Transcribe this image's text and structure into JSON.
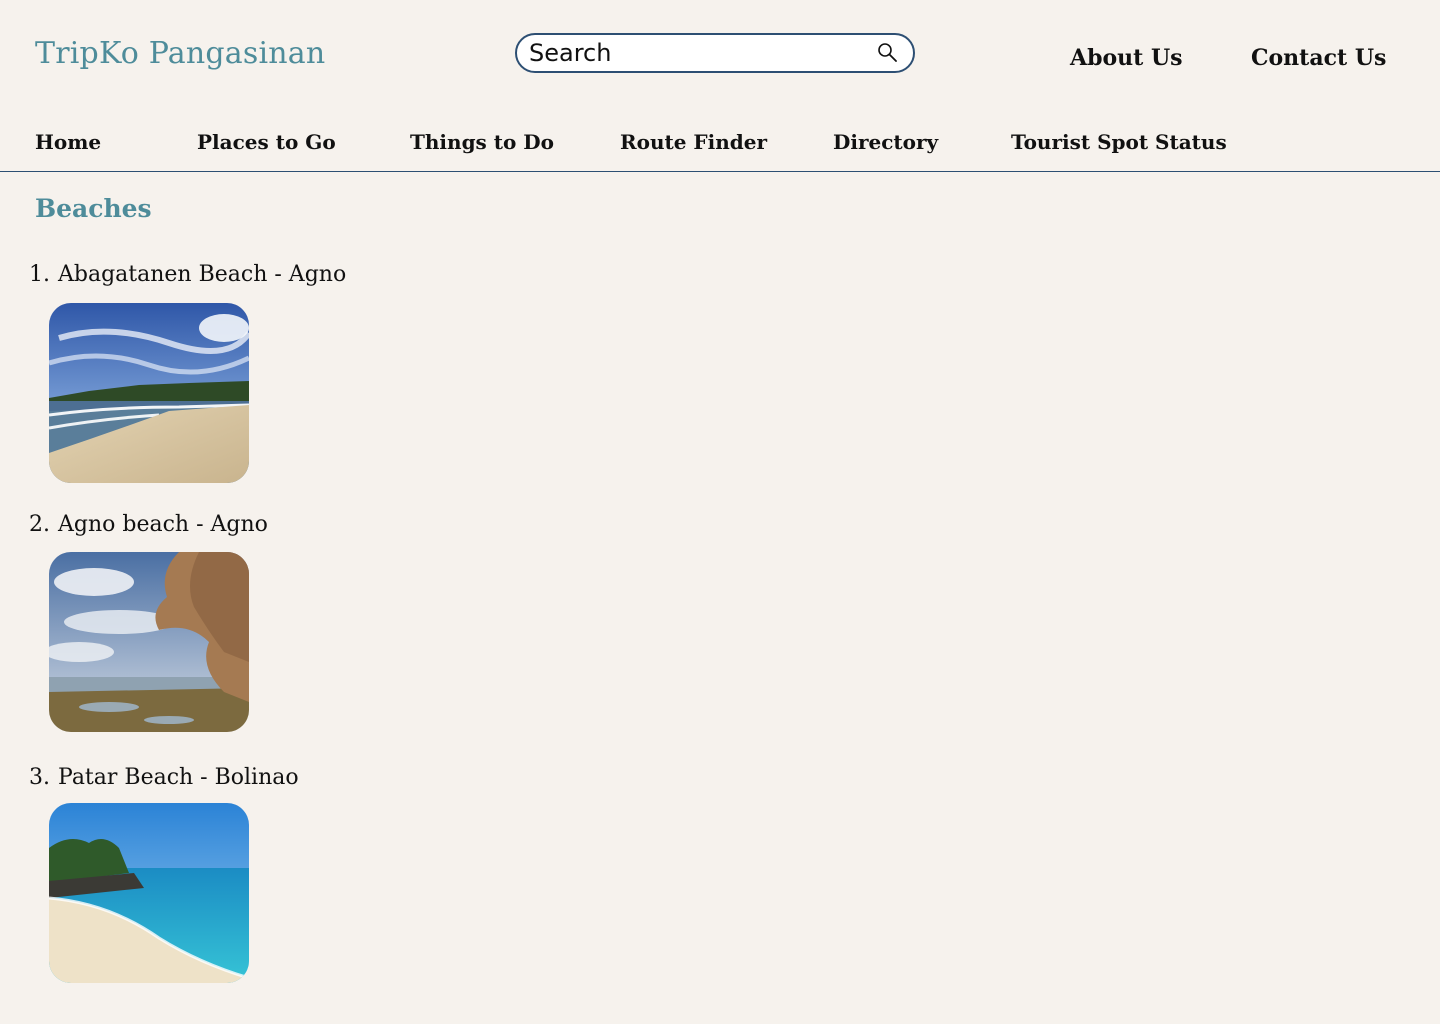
{
  "header": {
    "brand": "TripKo Pangasinan",
    "search": {
      "placeholder": "Search",
      "icon": "search-icon"
    },
    "links": {
      "about": "About Us",
      "contact": "Contact Us"
    }
  },
  "nav": {
    "items": [
      "Home",
      "Places to Go",
      "Things to Do",
      "Route Finder",
      "Directory",
      "Tourist Spot Status"
    ]
  },
  "main": {
    "section_title": "Beaches",
    "beaches": [
      {
        "number": "1.",
        "name": "Abagatanen Beach - Agno",
        "image": "beach-shoreline-photo"
      },
      {
        "number": "2.",
        "name": "Agno beach - Agno",
        "image": "rock-formation-photo"
      },
      {
        "number": "3.",
        "name": "Patar Beach - Bolinao",
        "image": "turquoise-beach-photo"
      }
    ]
  },
  "colors": {
    "background": "#f6f2ed",
    "accent": "#4e8c9a",
    "border": "#2d4f73",
    "text": "#111111"
  }
}
